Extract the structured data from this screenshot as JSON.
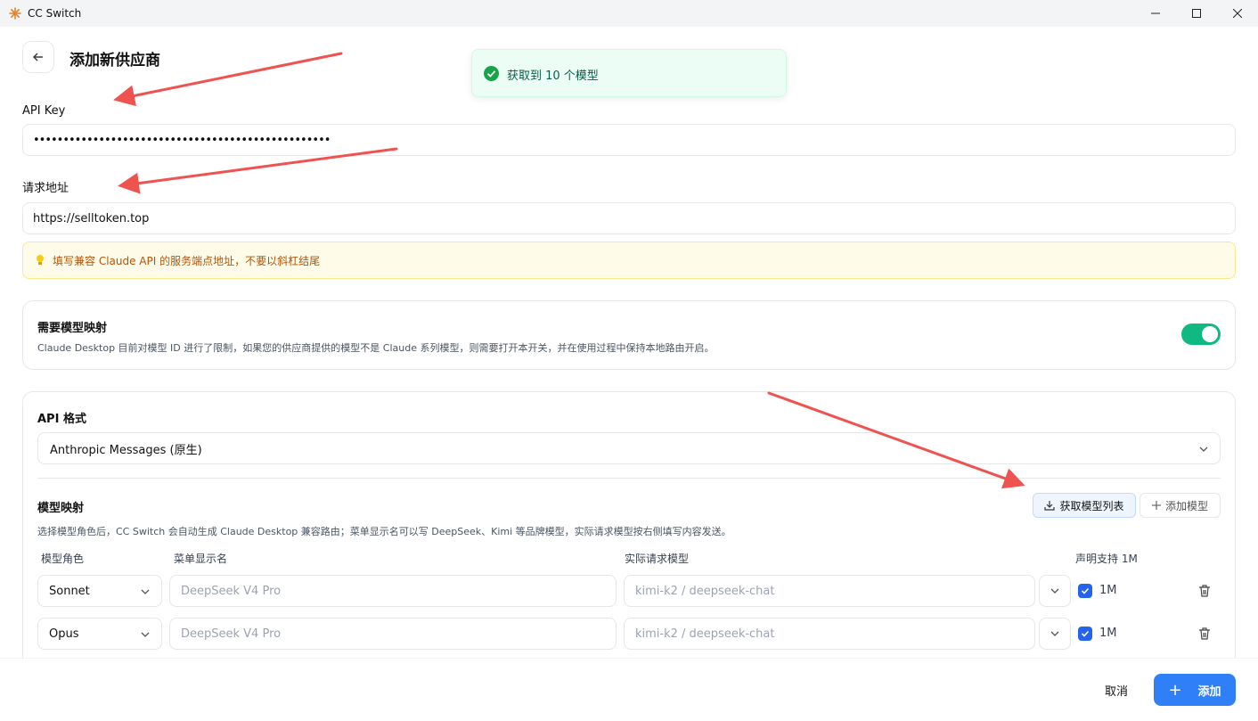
{
  "window": {
    "title": "CC Switch"
  },
  "page": {
    "title": "添加新供应商"
  },
  "toast": {
    "message": "获取到 10 个模型"
  },
  "api_key": {
    "label": "API Key",
    "value": "••••••••••••••••••••••••••••••••••••••••••••••••••"
  },
  "endpoint": {
    "label": "请求地址",
    "value": "https://selltoken.top",
    "hint": "填写兼容 Claude API 的服务端点地址，不要以斜杠结尾"
  },
  "model_mapping_toggle": {
    "title": "需要模型映射",
    "description": "Claude Desktop 目前对模型 ID 进行了限制，如果您的供应商提供的模型不是 Claude 系列模型，则需要打开本开关，并在使用过程中保持本地路由开启。",
    "enabled": true
  },
  "api_format": {
    "label": "API 格式",
    "selected": "Anthropic Messages (原生)"
  },
  "model_mapping": {
    "title": "模型映射",
    "description": "选择模型角色后，CC Switch 会自动生成 Claude Desktop 兼容路由；菜单显示名可以写 DeepSeek、Kimi 等品牌模型，实际请求模型按右侧填写内容发送。",
    "fetch_button": "获取模型列表",
    "add_button": "添加模型",
    "columns": {
      "role": "模型角色",
      "display_name": "菜单显示名",
      "actual_model": "实际请求模型",
      "support_1m": "声明支持 1M"
    },
    "rows": [
      {
        "role": "Sonnet",
        "display_placeholder": "DeepSeek V4 Pro",
        "model_placeholder": "kimi-k2 / deepseek-chat",
        "checked": true,
        "check_label": "1M"
      },
      {
        "role": "Opus",
        "display_placeholder": "DeepSeek V4 Pro",
        "model_placeholder": "kimi-k2 / deepseek-chat",
        "checked": true,
        "check_label": "1M"
      }
    ]
  },
  "footer": {
    "cancel": "取消",
    "add": "添加"
  },
  "colors": {
    "accent": "#2f80f7",
    "toggle_on": "#10b981",
    "annotation_arrow": "#ef4444"
  }
}
